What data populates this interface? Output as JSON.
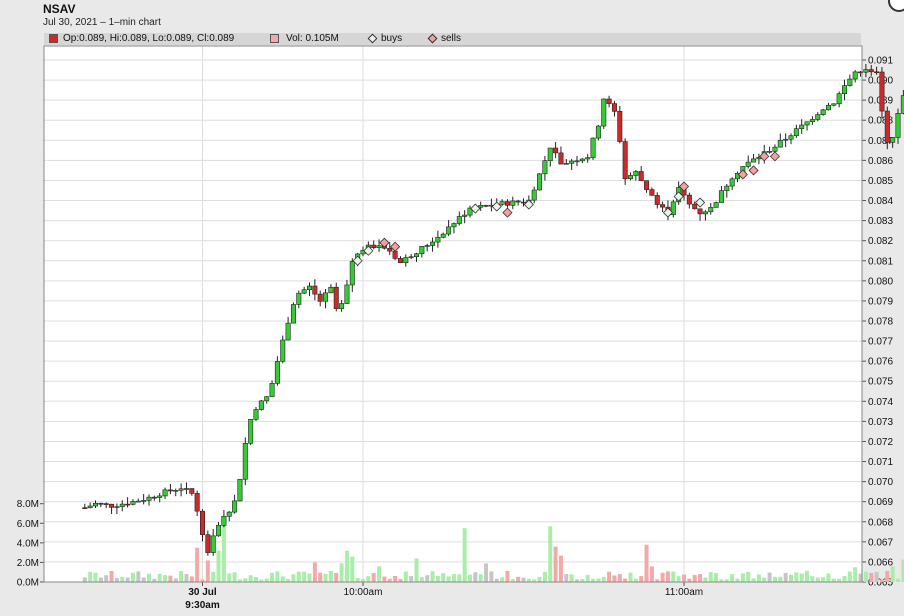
{
  "header": {
    "symbol": "NSAV",
    "subtitle": "Jul 30, 2021 – 1–min chart"
  },
  "legend": {
    "ohlc_text": "Op:0.089, Hi:0.089, Lo:0.089, Cl:0.089",
    "vol_text": "Vol: 0.105M",
    "buys_label": "buys",
    "sells_label": "sells"
  },
  "colors": {
    "up": "#33cc33",
    "down": "#cc2a2a",
    "vol_up": "#a8eea8",
    "vol_down": "#f4a8a8",
    "vol_flat": "#c6c6c6",
    "buy_marker": "#e8f5e8",
    "sell_marker": "#f4a0a0",
    "plot_bg": "#ffffff",
    "grid": "#dddddd"
  },
  "chart_data": {
    "type": "candlestick",
    "interval": "1-min",
    "price_range": [
      0.065,
      0.0915
    ],
    "price_ticks": [
      "0.091",
      "0.090",
      "0.089",
      "0.088",
      "0.087",
      "0.086",
      "0.085",
      "0.084",
      "0.083",
      "0.082",
      "0.081",
      "0.080",
      "0.079",
      "0.078",
      "0.077",
      "0.076",
      "0.075",
      "0.074",
      "0.073",
      "0.072",
      "0.071",
      "0.070",
      "0.069",
      "0.068",
      "0.067",
      "0.066",
      "0.065"
    ],
    "volume_ticks": [
      "8.0M",
      "6.0M",
      "4.0M",
      "2.0M",
      "0.0M"
    ],
    "volume_range": [
      0,
      9.4
    ],
    "x_axis": {
      "session_start": "9:30",
      "labels": [
        {
          "time": "9:30",
          "line1": "30 Jul",
          "line2": "9:30am"
        },
        {
          "time": "10:00",
          "line1": "10:00am",
          "line2": ""
        },
        {
          "time": "11:00",
          "line1": "11:00am",
          "line2": ""
        }
      ]
    },
    "price_path": [
      [
        "9:08",
        0.0687
      ],
      [
        "9:10",
        0.0689
      ],
      [
        "9:13",
        0.0688
      ],
      [
        "9:17",
        0.069
      ],
      [
        "9:20",
        0.0692
      ],
      [
        "9:22",
        0.0694
      ],
      [
        "9:26",
        0.0697
      ],
      [
        "9:28",
        0.0694
      ],
      [
        "9:29",
        0.0686
      ],
      [
        "9:30",
        0.0673
      ],
      [
        "9:31",
        0.0665
      ],
      [
        "9:32",
        0.0674
      ],
      [
        "9:34",
        0.0682
      ],
      [
        "9:35",
        0.0686
      ],
      [
        "9:36",
        0.069
      ],
      [
        "9:37",
        0.0702
      ],
      [
        "9:38",
        0.0719
      ],
      [
        "9:39",
        0.0731
      ],
      [
        "9:40",
        0.0737
      ],
      [
        "9:42",
        0.0742
      ],
      [
        "9:43",
        0.0749
      ],
      [
        "9:44",
        0.076
      ],
      [
        "9:45",
        0.077
      ],
      [
        "9:46",
        0.078
      ],
      [
        "9:47",
        0.0789
      ],
      [
        "9:48",
        0.0794
      ],
      [
        "9:50",
        0.0797
      ],
      [
        "9:52",
        0.079
      ],
      [
        "9:54",
        0.0796
      ],
      [
        "9:55",
        0.0786
      ],
      [
        "9:56",
        0.0788
      ],
      [
        "9:57",
        0.0797
      ],
      [
        "9:58",
        0.081
      ],
      [
        "10:00",
        0.0816
      ],
      [
        "10:03",
        0.0818
      ],
      [
        "10:05",
        0.0815
      ],
      [
        "10:07",
        0.0809
      ],
      [
        "10:09",
        0.0813
      ],
      [
        "10:12",
        0.0818
      ],
      [
        "10:14",
        0.0822
      ],
      [
        "10:17",
        0.0829
      ],
      [
        "10:20",
        0.0836
      ],
      [
        "10:24",
        0.0838
      ],
      [
        "10:28",
        0.0839
      ],
      [
        "10:31",
        0.084
      ],
      [
        "10:33",
        0.0853
      ],
      [
        "10:35",
        0.0867
      ],
      [
        "10:37",
        0.0858
      ],
      [
        "10:39",
        0.086
      ],
      [
        "10:42",
        0.0862
      ],
      [
        "10:44",
        0.0878
      ],
      [
        "10:45",
        0.0891
      ],
      [
        "10:47",
        0.0884
      ],
      [
        "10:48",
        0.087
      ],
      [
        "10:49",
        0.0851
      ],
      [
        "10:51",
        0.0854
      ],
      [
        "10:53",
        0.0846
      ],
      [
        "10:55",
        0.0838
      ],
      [
        "10:57",
        0.0834
      ],
      [
        "10:58",
        0.084
      ],
      [
        "10:59",
        0.0846
      ],
      [
        "11:01",
        0.0838
      ],
      [
        "11:03",
        0.0834
      ],
      [
        "11:05",
        0.0836
      ],
      [
        "11:07",
        0.0844
      ],
      [
        "11:09",
        0.0852
      ],
      [
        "11:11",
        0.0857
      ],
      [
        "11:14",
        0.0862
      ],
      [
        "11:17",
        0.0867
      ],
      [
        "11:20",
        0.0873
      ],
      [
        "11:23",
        0.0879
      ],
      [
        "11:26",
        0.0886
      ],
      [
        "11:28",
        0.0889
      ],
      [
        "11:30",
        0.0897
      ],
      [
        "11:32",
        0.0904
      ],
      [
        "11:34",
        0.0906
      ],
      [
        "11:36",
        0.0903
      ],
      [
        "11:37",
        0.0884
      ],
      [
        "11:38",
        0.087
      ],
      [
        "11:39",
        0.0872
      ],
      [
        "11:40",
        0.0884
      ],
      [
        "11:41",
        0.0893
      ],
      [
        "11:42",
        0.0898
      ],
      [
        "11:43",
        0.0893
      ]
    ],
    "volume_spikes": [
      [
        "9:29",
        3.5
      ],
      [
        "9:31",
        2.2
      ],
      [
        "9:33",
        3.2
      ],
      [
        "9:34",
        6.3
      ],
      [
        "9:51",
        2.0
      ],
      [
        "9:56",
        1.9
      ],
      [
        "9:57",
        3.2
      ],
      [
        "9:58",
        2.6
      ],
      [
        "10:03",
        1.6
      ],
      [
        "10:10",
        2.4
      ],
      [
        "10:19",
        5.5
      ],
      [
        "10:23",
        1.9
      ],
      [
        "10:35",
        5.7
      ],
      [
        "10:36",
        3.6
      ],
      [
        "10:37",
        2.7
      ],
      [
        "10:53",
        3.8
      ],
      [
        "10:54",
        1.6
      ],
      [
        "11:32",
        1.5
      ],
      [
        "11:39",
        1.6
      ],
      [
        "11:41",
        2.3
      ],
      [
        "11:42",
        2.0
      ]
    ],
    "buys": [
      [
        "9:59",
        0.081
      ],
      [
        "10:01",
        0.0815
      ],
      [
        "10:21",
        0.0836
      ],
      [
        "10:25",
        0.0837
      ],
      [
        "10:31",
        0.0838
      ],
      [
        "10:57",
        0.0834
      ],
      [
        "10:59",
        0.0842
      ],
      [
        "11:03",
        0.0839
      ]
    ],
    "sells": [
      [
        "10:04",
        0.0819
      ],
      [
        "10:06",
        0.0817
      ],
      [
        "10:27",
        0.0834
      ],
      [
        "11:00",
        0.0847
      ],
      [
        "11:11",
        0.0853
      ],
      [
        "11:13",
        0.0855
      ],
      [
        "11:15",
        0.0862
      ],
      [
        "11:17",
        0.0862
      ]
    ]
  }
}
